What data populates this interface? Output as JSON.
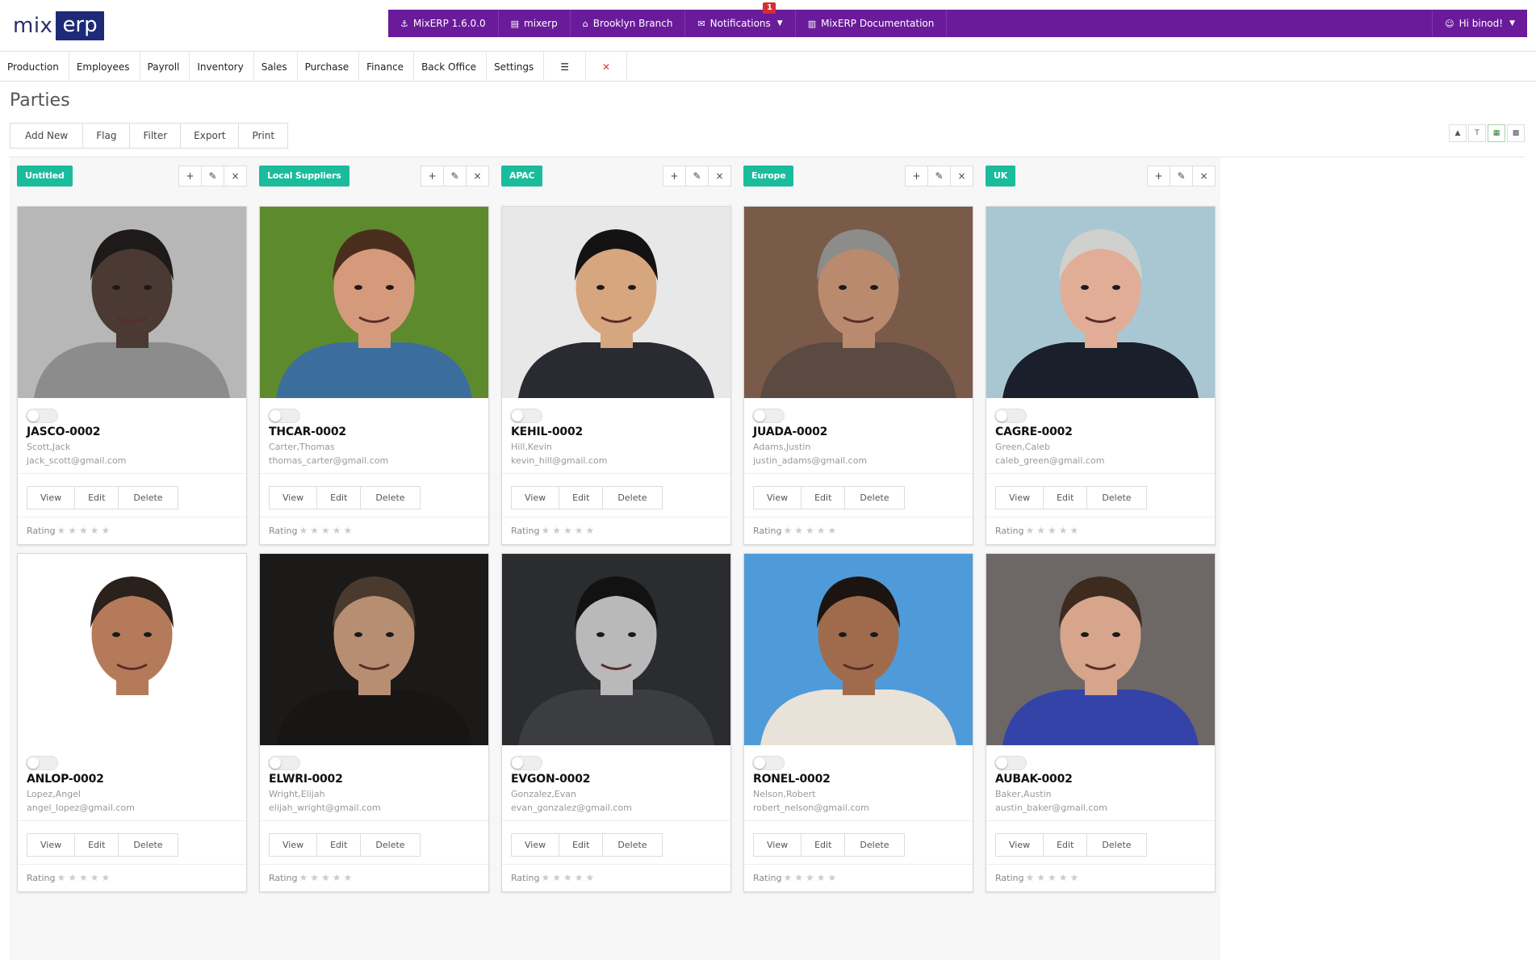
{
  "logo": {
    "mix": "mix",
    "erp": "erp"
  },
  "topbar": {
    "version": "MixERP 1.6.0.0",
    "db": "mixerp",
    "branch": "Brooklyn Branch",
    "notifications": "Notifications",
    "notif_count": "1",
    "docs": "MixERP Documentation",
    "user": "Hi binod!"
  },
  "nav": [
    "Production",
    "Employees",
    "Payroll",
    "Inventory",
    "Sales",
    "Purchase",
    "Finance",
    "Back Office",
    "Settings"
  ],
  "page_title": "Parties",
  "toolbar": [
    "Add New",
    "Flag",
    "Filter",
    "Export",
    "Print"
  ],
  "rating_label": "Rating",
  "stars": "★★★★★",
  "buttons": {
    "view": "View",
    "edit": "Edit",
    "delete": "Delete"
  },
  "columns": [
    {
      "tag": "Untitled",
      "cards": [
        {
          "id": "JASCO-0002",
          "name": "Scott,Jack",
          "email": "jack_scott@gmail.com",
          "bg": "#b7b7b7",
          "skin": "#4a3a33",
          "hair": "#1d1a19",
          "shirt": "#8c8c8c"
        },
        {
          "id": "ANLOP-0002",
          "name": "Lopez,Angel",
          "email": "angel_lopez@gmail.com",
          "bg": "#ffffff",
          "skin": "#b57a5a",
          "hair": "#2a201c",
          "shirt": "#ffffff"
        }
      ]
    },
    {
      "tag": "Local Suppliers",
      "cards": [
        {
          "id": "THCAR-0002",
          "name": "Carter,Thomas",
          "email": "thomas_carter@gmail.com",
          "bg": "#5e8a2e",
          "skin": "#d59a7c",
          "hair": "#4a2e1d",
          "shirt": "#3b6e9c"
        },
        {
          "id": "ELWRI-0002",
          "name": "Wright,Elijah",
          "email": "elijah_wright@gmail.com",
          "bg": "#1c1a18",
          "skin": "#b88e73",
          "hair": "#4a3a2e",
          "shirt": "#181614"
        }
      ]
    },
    {
      "tag": "APAC",
      "cards": [
        {
          "id": "KEHIL-0002",
          "name": "Hill,Kevin",
          "email": "kevin_hill@gmail.com",
          "bg": "#e8e8e8",
          "skin": "#d6a67f",
          "hair": "#141212",
          "shirt": "#2a2a33"
        },
        {
          "id": "EVGON-0002",
          "name": "Gonzalez,Evan",
          "email": "evan_gonzalez@gmail.com",
          "bg": "#2a2c30",
          "skin": "#b9b9b9",
          "hair": "#121212",
          "shirt": "#3c3d40"
        }
      ]
    },
    {
      "tag": "Europe",
      "cards": [
        {
          "id": "JUADA-0002",
          "name": "Adams,Justin",
          "email": "justin_adams@gmail.com",
          "bg": "#7a5a48",
          "skin": "#b98a6e",
          "hair": "#8c8c8a",
          "shirt": "#5a4a42"
        },
        {
          "id": "RONEL-0002",
          "name": "Nelson,Robert",
          "email": "robert_nelson@gmail.com",
          "bg": "#4f9bd9",
          "skin": "#a06b4c",
          "hair": "#1c1411",
          "shirt": "#e8e2d8"
        }
      ]
    },
    {
      "tag": "UK",
      "cards": [
        {
          "id": "CAGRE-0002",
          "name": "Green,Caleb",
          "email": "caleb_green@gmail.com",
          "bg": "#a9c7d2",
          "skin": "#e1ad96",
          "hair": "#d0d0cc",
          "shirt": "#1a1f2b"
        },
        {
          "id": "AUBAK-0002",
          "name": "Baker,Austin",
          "email": "austin_baker@gmail.com",
          "bg": "#6d6866",
          "skin": "#d7a48c",
          "hair": "#3e2b1f",
          "shirt": "#3343a8"
        }
      ]
    }
  ]
}
